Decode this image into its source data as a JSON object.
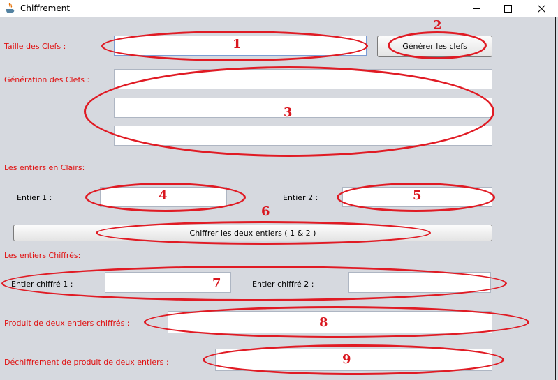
{
  "window": {
    "title": "Chiffrement",
    "minimize_glyph": "—",
    "close_glyph": "✕"
  },
  "keys": {
    "size_label": "Taille des Clefs :",
    "size_value": "",
    "generate_button": "Générer les clefs",
    "generation_label": "Génération des Clefs :",
    "key_fields": [
      "",
      "",
      ""
    ]
  },
  "plain": {
    "section_label": "Les entiers en Clairs:",
    "int1_label": "Entier 1 :",
    "int1_value": "",
    "int2_label": "Entier 2 :",
    "int2_value": "",
    "encrypt_button": "Chiffrer les deux entiers ( 1 & 2 )"
  },
  "cipher": {
    "section_label": "Les entiers Chiffrés:",
    "c1_label": "Entier chiffré 1 :",
    "c1_value": "",
    "c2_label": "Entier chiffré 2 :",
    "c2_value": "",
    "product_label": "Produit de deux entiers chiffrés :",
    "product_value": "",
    "decrypt_label": "Déchiffrement de produit de deux entiers :",
    "decrypt_value": ""
  },
  "annotations": [
    "1",
    "2",
    "3",
    "4",
    "5",
    "6",
    "7",
    "8",
    "9"
  ],
  "colors": {
    "label_red": "#e01010",
    "annotation_red": "#e01b24",
    "background": "#d6d9df"
  }
}
